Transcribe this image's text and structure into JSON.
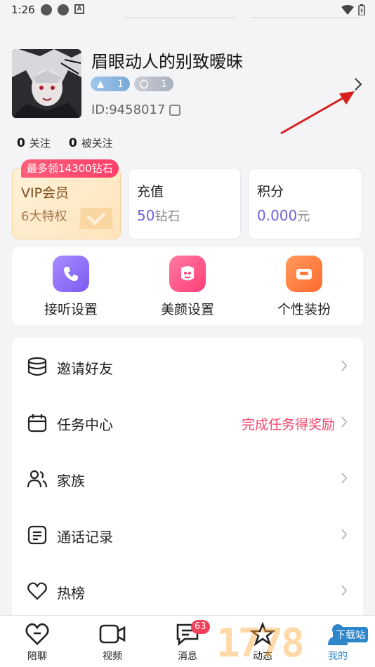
{
  "status_bar": {
    "time": "1:26"
  },
  "profile": {
    "nickname": "眉眼动人的别致暧昧",
    "badge_1_value": "1",
    "badge_2_value": "1",
    "user_id": "ID:9458017"
  },
  "follows": {
    "following_count": "0",
    "following_label": "关注",
    "followers_count": "0",
    "followers_label": "被关注"
  },
  "cards": {
    "vip_tag": "最多领14300钻石",
    "vip_title": "VIP会员",
    "vip_sub": "6大特权",
    "recharge_title": "充值",
    "recharge_value": "50",
    "recharge_unit": "钻石",
    "points_title": "积分",
    "points_value": "0.000",
    "points_unit": "元"
  },
  "quick_actions": [
    {
      "label": "接听设置",
      "icon": "phone-icon",
      "color": "#8b6cf3"
    },
    {
      "label": "美颜设置",
      "icon": "beauty-icon",
      "color": "#ff4f86"
    },
    {
      "label": "个性装扮",
      "icon": "sofa-icon",
      "color": "#ff7a3d"
    }
  ],
  "menu": [
    {
      "label": "邀请好友",
      "icon": "database-icon",
      "extra": ""
    },
    {
      "label": "任务中心",
      "icon": "calendar-icon",
      "extra": "完成任务得奖励"
    },
    {
      "label": "家族",
      "icon": "users-icon",
      "extra": ""
    },
    {
      "label": "通话记录",
      "icon": "document-icon",
      "extra": ""
    },
    {
      "label": "热榜",
      "icon": "heart-icon",
      "extra": ""
    }
  ],
  "bottom_nav": [
    {
      "label": "陪聊",
      "icon": "heart-chat-icon"
    },
    {
      "label": "视频",
      "icon": "video-icon"
    },
    {
      "label": "消息",
      "icon": "message-icon",
      "badge": "63"
    },
    {
      "label": "动态",
      "icon": "star-icon"
    },
    {
      "label": "我的",
      "icon": "profile-icon"
    }
  ],
  "watermark": {
    "text": "1778",
    "badge_text": "下载站"
  },
  "colors": {
    "accent_purple": "#6b63d8",
    "accent_red": "#f2486e",
    "badge_red": "#f23f5a"
  }
}
